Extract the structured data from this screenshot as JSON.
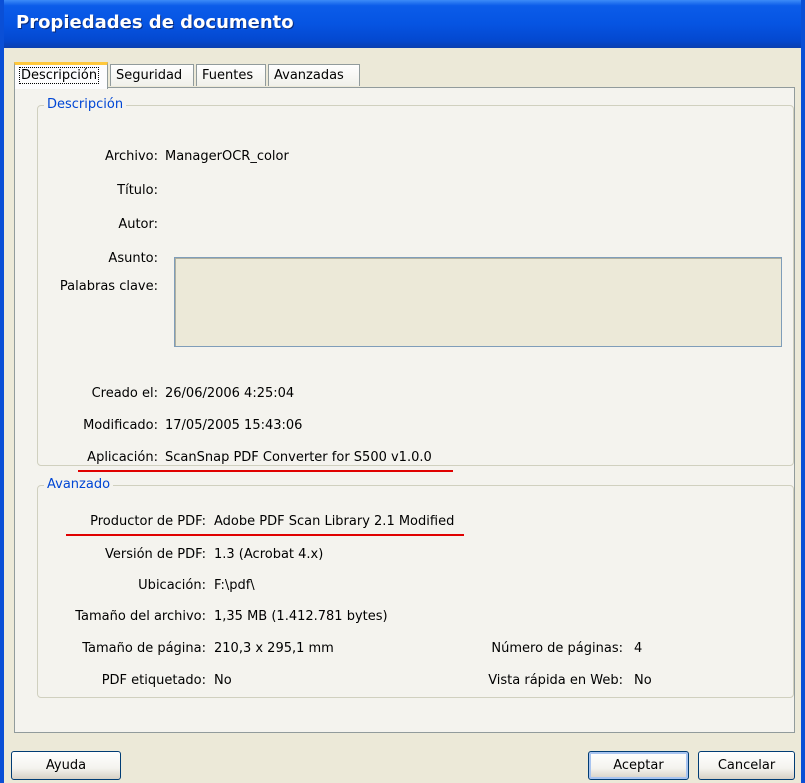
{
  "window": {
    "title": "Propiedades de documento"
  },
  "tabs": [
    {
      "label": "Descripción"
    },
    {
      "label": "Seguridad"
    },
    {
      "label": "Fuentes"
    },
    {
      "label": "Avanzadas"
    }
  ],
  "descripcion": {
    "group_title": "Descripción",
    "archivo": {
      "label": "Archivo:",
      "value": "ManagerOCR_color"
    },
    "titulo": {
      "label": "Título:",
      "value": ""
    },
    "autor": {
      "label": "Autor:",
      "value": ""
    },
    "asunto": {
      "label": "Asunto:",
      "value": ""
    },
    "palabras_clave": {
      "label": "Palabras clave:",
      "value": ""
    },
    "creado": {
      "label": "Creado el:",
      "value": "26/06/2006 4:25:04"
    },
    "modificado": {
      "label": "Modificado:",
      "value": "17/05/2005 15:43:06"
    },
    "aplicacion": {
      "label": "Aplicación:",
      "value": "ScanSnap PDF Converter for S500 v1.0.0"
    }
  },
  "avanzado": {
    "group_title": "Avanzado",
    "productor": {
      "label": "Productor de PDF:",
      "value": "Adobe PDF Scan Library 2.1 Modified"
    },
    "version": {
      "label": "Versión de PDF:",
      "value": "1.3 (Acrobat 4.x)"
    },
    "ubicacion": {
      "label": "Ubicación:",
      "value": "F:\\pdf\\"
    },
    "tamano_archivo": {
      "label": "Tamaño del archivo:",
      "value": "1,35 MB (1.412.781 bytes)"
    },
    "tamano_pagina": {
      "label": "Tamaño de página:",
      "value": "210,3 x 295,1 mm"
    },
    "numero_paginas": {
      "label": "Número de páginas:",
      "value": "4"
    },
    "pdf_etiquetado": {
      "label": "PDF etiquetado:",
      "value": "No"
    },
    "vista_rapida": {
      "label": "Vista rápida en Web:",
      "value": "No"
    }
  },
  "buttons": {
    "help": "Ayuda",
    "ok": "Aceptar",
    "cancel": "Cancelar"
  },
  "colors": {
    "highlight_underline": "#e00000",
    "group_title": "#0046d5",
    "titlebar": "#0654e2"
  }
}
